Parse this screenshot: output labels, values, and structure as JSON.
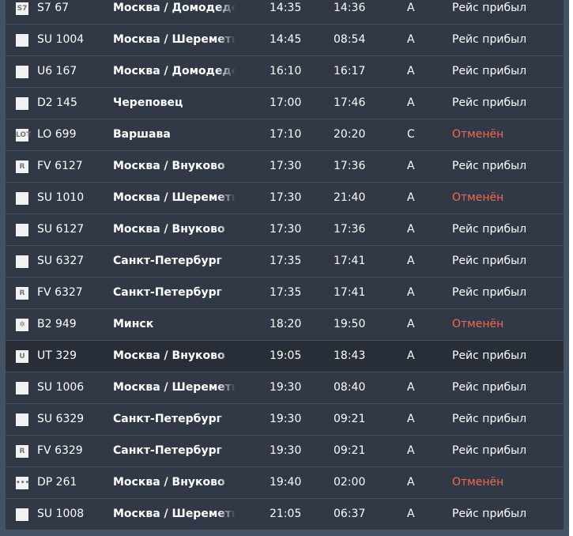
{
  "colors": {
    "background": "#435364",
    "panel": "#303945",
    "row_hover": "#272e37",
    "cancelled": "#ef6a4c",
    "text": "#ffffff"
  },
  "flights": [
    {
      "logo": "s7-logo-icon",
      "logo_text": "S7",
      "flight": "S7 67",
      "city": "Москва / Домодедово",
      "scheduled": "14:35",
      "actual": "14:36",
      "terminal": "A",
      "status": "Рейс прибыл",
      "cancelled": false
    },
    {
      "logo": "aeroflot-logo-icon",
      "logo_text": "",
      "flight": "SU 1004",
      "city": "Москва / Шереметьево",
      "scheduled": "14:45",
      "actual": "08:54",
      "terminal": "A",
      "status": "Рейс прибыл",
      "cancelled": false
    },
    {
      "logo": "ural-logo-icon",
      "logo_text": "",
      "flight": "U6 167",
      "city": "Москва / Домодедово",
      "scheduled": "16:10",
      "actual": "16:17",
      "terminal": "A",
      "status": "Рейс прибыл",
      "cancelled": false
    },
    {
      "logo": "d2-logo-icon",
      "logo_text": "",
      "flight": "D2 145",
      "city": "Череповец",
      "scheduled": "17:00",
      "actual": "17:46",
      "terminal": "A",
      "status": "Рейс прибыл",
      "cancelled": false
    },
    {
      "logo": "lot-logo-icon",
      "logo_text": "LOT",
      "flight": "LO 699",
      "city": "Варшава",
      "scheduled": "17:10",
      "actual": "20:20",
      "terminal": "C",
      "status": "Отменён",
      "cancelled": true
    },
    {
      "logo": "rossiya-logo-icon",
      "logo_text": "R",
      "flight": "FV 6127",
      "city": "Москва / Внуково",
      "scheduled": "17:30",
      "actual": "17:36",
      "terminal": "A",
      "status": "Рейс прибыл",
      "cancelled": false
    },
    {
      "logo": "aeroflot-logo-icon",
      "logo_text": "",
      "flight": "SU 1010",
      "city": "Москва / Шереметьево",
      "scheduled": "17:30",
      "actual": "21:40",
      "terminal": "A",
      "status": "Отменён",
      "cancelled": true
    },
    {
      "logo": "aeroflot-logo-icon",
      "logo_text": "",
      "flight": "SU 6127",
      "city": "Москва / Внуково",
      "scheduled": "17:30",
      "actual": "17:36",
      "terminal": "A",
      "status": "Рейс прибыл",
      "cancelled": false
    },
    {
      "logo": "aeroflot-logo-icon",
      "logo_text": "",
      "flight": "SU 6327",
      "city": "Санкт-Петербург",
      "scheduled": "17:35",
      "actual": "17:41",
      "terminal": "A",
      "status": "Рейс прибыл",
      "cancelled": false
    },
    {
      "logo": "rossiya-logo-icon",
      "logo_text": "R",
      "flight": "FV 6327",
      "city": "Санкт-Петербург",
      "scheduled": "17:35",
      "actual": "17:41",
      "terminal": "A",
      "status": "Рейс прибыл",
      "cancelled": false
    },
    {
      "logo": "belavia-logo-icon",
      "logo_text": "✲",
      "flight": "B2 949",
      "city": "Минск",
      "scheduled": "18:20",
      "actual": "19:50",
      "terminal": "A",
      "status": "Отменён",
      "cancelled": true
    },
    {
      "logo": "utair-logo-icon",
      "logo_text": "U",
      "flight": "UT 329",
      "city": "Москва / Внуково",
      "scheduled": "19:05",
      "actual": "18:43",
      "terminal": "A",
      "status": "Рейс прибыл",
      "cancelled": false
    },
    {
      "logo": "aeroflot-logo-icon",
      "logo_text": "",
      "flight": "SU 1006",
      "city": "Москва / Шереметьево",
      "scheduled": "19:30",
      "actual": "08:40",
      "terminal": "A",
      "status": "Рейс прибыл",
      "cancelled": false
    },
    {
      "logo": "aeroflot-logo-icon",
      "logo_text": "",
      "flight": "SU 6329",
      "city": "Санкт-Петербург",
      "scheduled": "19:30",
      "actual": "09:21",
      "terminal": "A",
      "status": "Рейс прибыл",
      "cancelled": false
    },
    {
      "logo": "rossiya-logo-icon",
      "logo_text": "R",
      "flight": "FV 6329",
      "city": "Санкт-Петербург",
      "scheduled": "19:30",
      "actual": "09:21",
      "terminal": "A",
      "status": "Рейс прибыл",
      "cancelled": false
    },
    {
      "logo": "pobeda-logo-icon",
      "logo_text": "•••",
      "flight": "DP 261",
      "city": "Москва / Внуково",
      "scheduled": "19:40",
      "actual": "02:00",
      "terminal": "A",
      "status": "Отменён",
      "cancelled": true
    },
    {
      "logo": "aeroflot-logo-icon",
      "logo_text": "",
      "flight": "SU 1008",
      "city": "Москва / Шереметьево",
      "scheduled": "21:05",
      "actual": "06:37",
      "terminal": "A",
      "status": "Рейс прибыл",
      "cancelled": false
    }
  ]
}
